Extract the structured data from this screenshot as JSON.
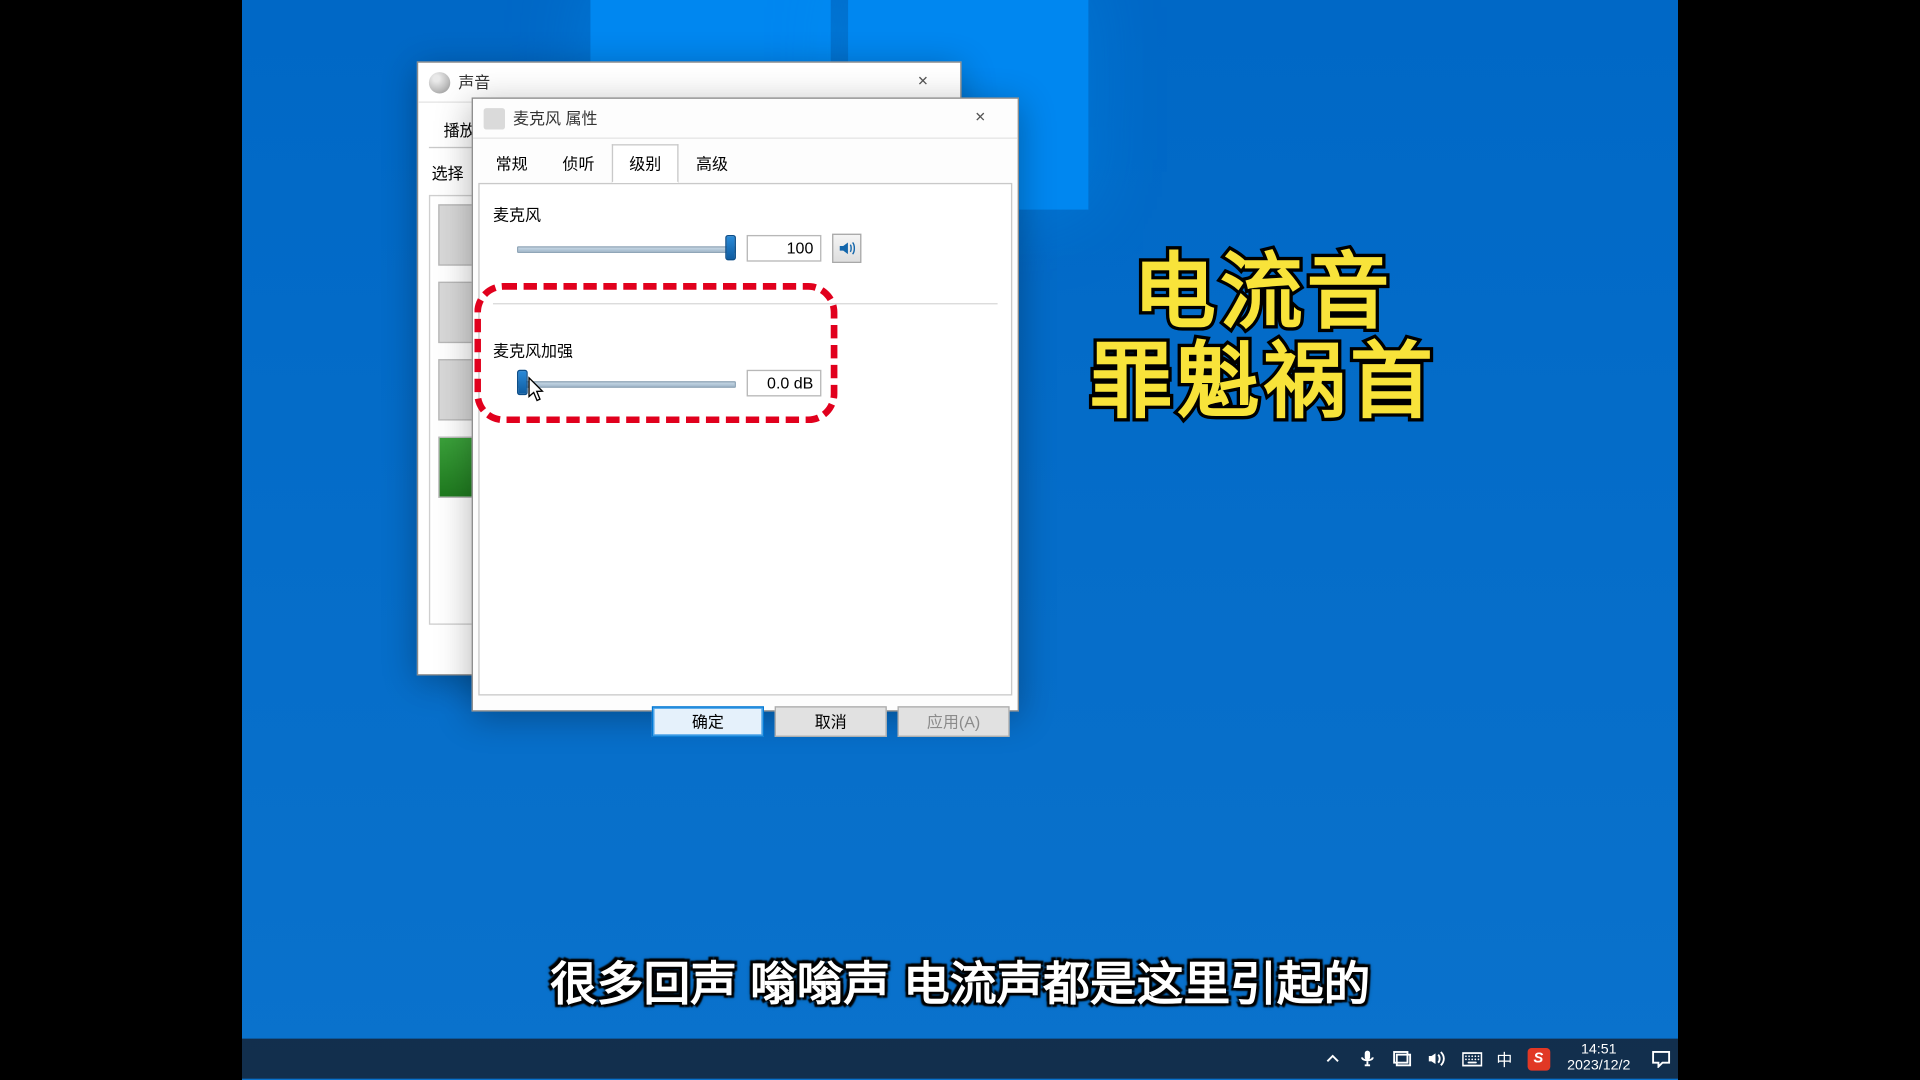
{
  "sound_window": {
    "title": "声音",
    "tabs": {
      "playback": "播放"
    },
    "hint_prefix": "选择"
  },
  "mic_window": {
    "title": "麦克风 属性",
    "tabs": {
      "general": "常规",
      "listen": "侦听",
      "levels": "级别",
      "advanced": "高级"
    },
    "group_mic": {
      "label": "麦克风",
      "value": "100",
      "percent": 100
    },
    "group_boost": {
      "label": "麦克风加强",
      "value": "0.0 dB",
      "percent": 0
    },
    "buttons": {
      "ok": "确定",
      "cancel": "取消",
      "apply": "应用(A)"
    }
  },
  "annotation": {
    "line1": "电流音",
    "line2": "罪魁祸首"
  },
  "subtitle": "很多回声 嗡嗡声 电流声都是这里引起的",
  "taskbar": {
    "ime": "中",
    "sogou": "S",
    "time": "14:51",
    "date": "2023/12/2"
  }
}
